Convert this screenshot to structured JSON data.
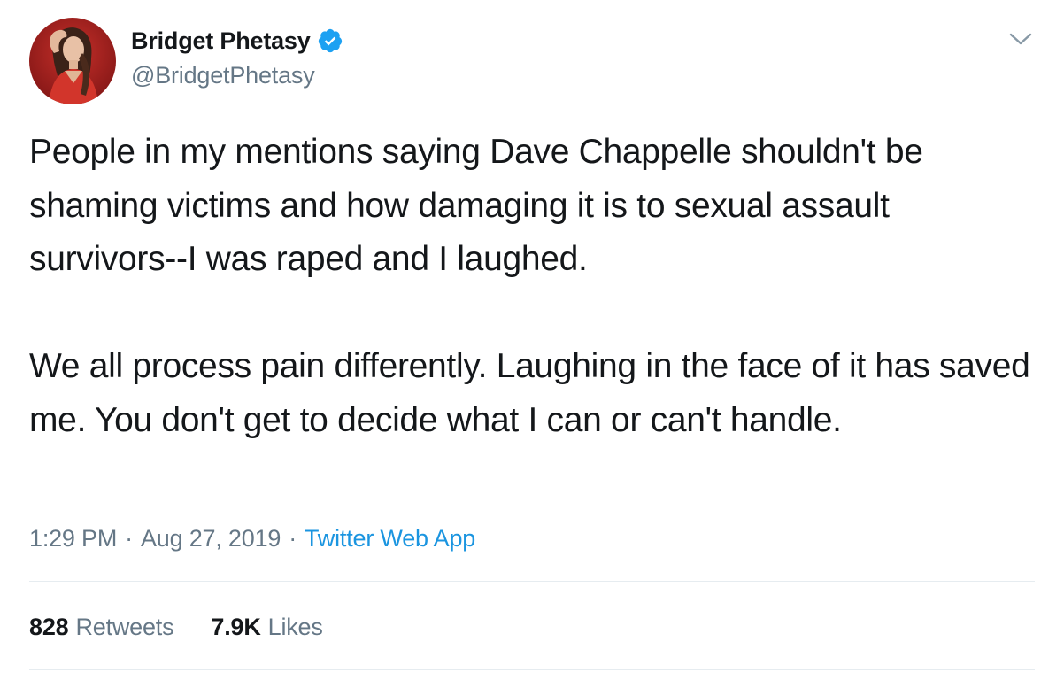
{
  "author": {
    "display_name": "Bridget Phetasy",
    "handle": "@BridgetPhetasy",
    "verified": true
  },
  "tweet": {
    "paragraphs": [
      "People in my mentions saying Dave Chappelle shouldn't be shaming victims and how damaging it is to sexual assault survivors--I was raped and I laughed.",
      "We all process pain differently. Laughing in the face of it has saved me. You don't get to decide what I can or can't handle."
    ],
    "time": "1:29 PM",
    "separator": "·",
    "date": "Aug 27, 2019",
    "source": "Twitter Web App"
  },
  "stats": {
    "retweets_count": "828",
    "retweets_label": "Retweets",
    "likes_count": "7.9K",
    "likes_label": "Likes"
  },
  "icons": {
    "verified": "verified-badge-icon",
    "caret": "chevron-down-icon"
  },
  "colors": {
    "text_primary": "#14171a",
    "text_secondary": "#657786",
    "link": "#1b95e0",
    "verified": "#1da1f2",
    "divider": "#e6ecf0",
    "avatar_background": "#9e1f1f"
  }
}
